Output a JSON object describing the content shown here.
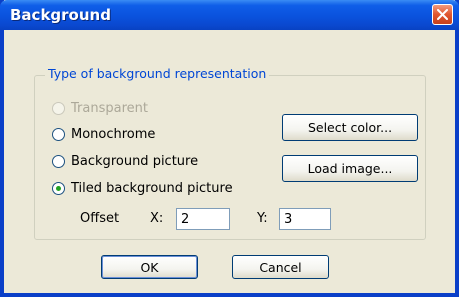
{
  "dialog": {
    "title": "Background"
  },
  "group": {
    "legend": "Type of background representation"
  },
  "options": [
    {
      "label": "Transparent",
      "selected": false,
      "disabled": true
    },
    {
      "label": "Monochrome",
      "selected": false,
      "disabled": false
    },
    {
      "label": "Background picture",
      "selected": false,
      "disabled": false
    },
    {
      "label": "Tiled background picture",
      "selected": true,
      "disabled": false
    }
  ],
  "buttons": {
    "select_color": "Select color...",
    "load_image": "Load image...",
    "ok": "OK",
    "cancel": "Cancel"
  },
  "offset": {
    "label": "Offset",
    "x_label": "X:",
    "x_value": "2",
    "y_label": "Y:",
    "y_value": "3"
  },
  "colors": {
    "title_bar": "#0a52dd",
    "dialog_bg": "#ece9d8",
    "legend_text": "#0046d5",
    "radio_selected": "#21a121",
    "close_button": "#e0562f"
  },
  "icons": {
    "close": "close-icon"
  }
}
